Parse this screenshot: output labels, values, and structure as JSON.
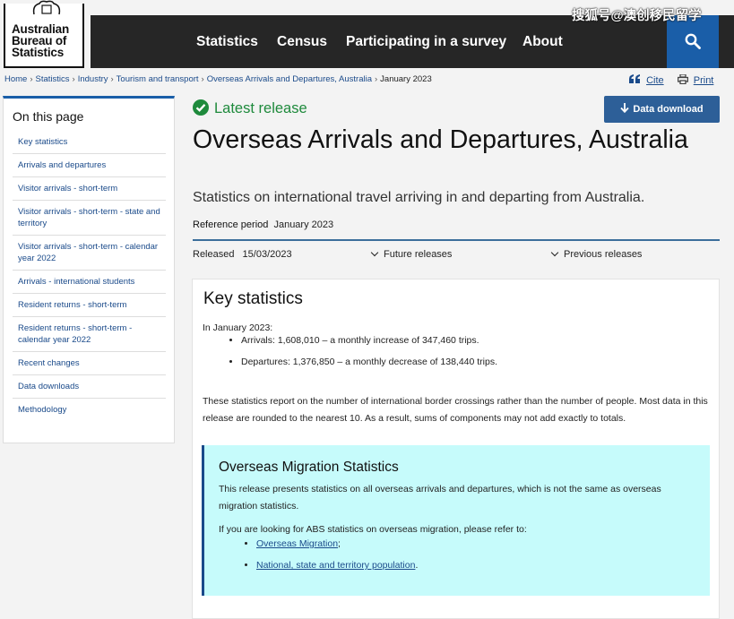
{
  "logo": {
    "lines": [
      "Australian",
      "Bureau of",
      "Statistics"
    ]
  },
  "nav": {
    "items": [
      "Statistics",
      "Census",
      "Participating in a survey",
      "About"
    ]
  },
  "watermark": "搜狐号@澳创移民留学",
  "breadcrumb": {
    "items": [
      "Home",
      "Statistics",
      "Industry",
      "Tourism and transport",
      "Overseas Arrivals and Departures, Australia"
    ],
    "current": "January 2023"
  },
  "actions": {
    "cite": "Cite",
    "print": "Print"
  },
  "sidebar": {
    "title": "On this page",
    "items": [
      "Key statistics",
      "Arrivals and departures",
      "Visitor arrivals - short-term",
      "Visitor arrivals - short-term - state and territory",
      "Visitor arrivals - short-term - calendar year 2022",
      "Arrivals - international students",
      "Resident returns - short-term",
      "Resident returns - short-term - calendar year 2022",
      "Recent changes",
      "Data downloads",
      "Methodology"
    ]
  },
  "header": {
    "latest_release": "Latest release",
    "download_button": "Data download",
    "title": "Overseas Arrivals and Departures, Australia",
    "subtitle": "Statistics on international travel arriving in and departing from Australia.",
    "reference_period_label": "Reference period",
    "reference_period_value": "January 2023",
    "released_label": "Released",
    "released_value": "15/03/2023",
    "future_releases": "Future releases",
    "previous_releases": "Previous releases"
  },
  "key_statistics": {
    "title": "Key statistics",
    "intro": "In January 2023:",
    "bullets": [
      "Arrivals: 1,608,010 – a monthly increase of 347,460 trips.",
      "Departures: 1,376,850 – a monthly decrease of 138,440 trips."
    ],
    "paragraph": "These statistics report on the number of international border crossings rather than the number of people. Most data in this release are rounded to the nearest 10. As a result, sums of components may not add exactly to totals."
  },
  "callout": {
    "title": "Overseas Migration Statistics",
    "paragraph1": "This release presents statistics on all overseas arrivals and departures, which is not the same as overseas migration statistics.",
    "paragraph2": "If you are looking for ABS statistics on overseas migration, please refer to:",
    "links": [
      "Overseas Migration",
      "National, state and territory population"
    ],
    "link_suffixes": [
      ";",
      "."
    ]
  },
  "colors": {
    "nav_bg": "#262626",
    "accent_blue": "#1a5ea8",
    "release_green": "#1e8a3c",
    "callout_bg": "#c6fbfb"
  },
  "icons": [
    "search-icon",
    "check-circle-icon",
    "download-arrow-icon",
    "quote-icon",
    "print-icon",
    "chevron-down-icon"
  ]
}
